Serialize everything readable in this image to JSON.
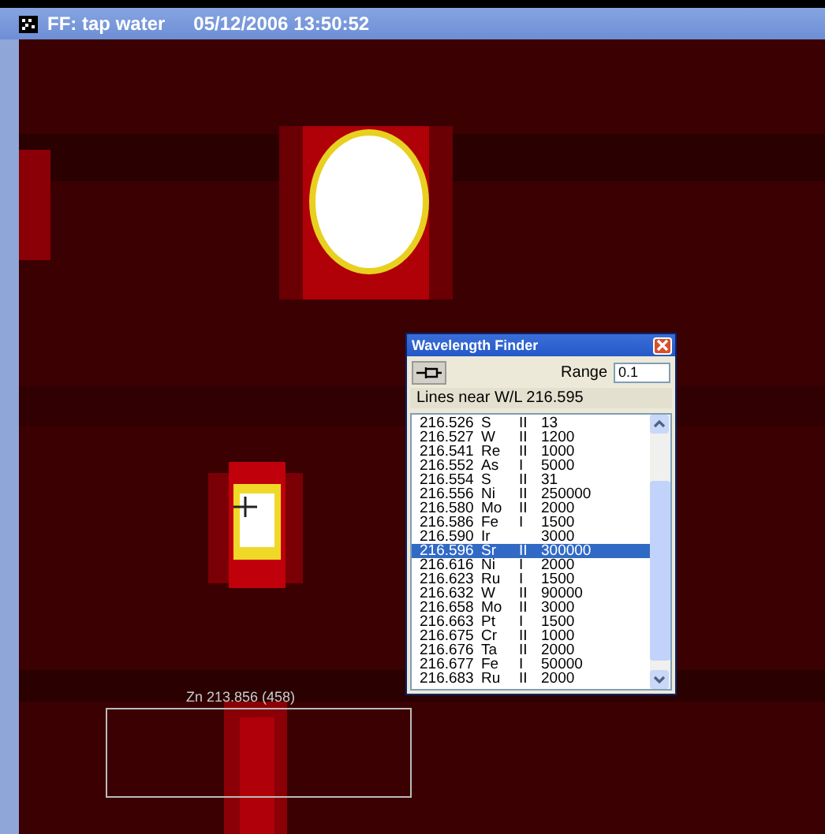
{
  "window": {
    "title": "FF: tap water",
    "timestamp": "05/12/2006 13:50:52"
  },
  "region_label": "Zn 213.856 (458)",
  "finder": {
    "title": "Wavelength Finder",
    "range_label": "Range",
    "range_value": "0.1",
    "lines_near": "Lines near W/L  216.595",
    "lines": [
      {
        "wavelength": "216.526",
        "element": "S",
        "ion": "II",
        "intensity": "13",
        "selected": false
      },
      {
        "wavelength": "216.527",
        "element": "W",
        "ion": "II",
        "intensity": "1200",
        "selected": false
      },
      {
        "wavelength": "216.541",
        "element": "Re",
        "ion": "II",
        "intensity": "1000",
        "selected": false
      },
      {
        "wavelength": "216.552",
        "element": "As",
        "ion": "I",
        "intensity": "5000",
        "selected": false
      },
      {
        "wavelength": "216.554",
        "element": "S",
        "ion": "II",
        "intensity": "31",
        "selected": false
      },
      {
        "wavelength": "216.556",
        "element": "Ni",
        "ion": "II",
        "intensity": "250000",
        "selected": false
      },
      {
        "wavelength": "216.580",
        "element": "Mo",
        "ion": "II",
        "intensity": "2000",
        "selected": false
      },
      {
        "wavelength": "216.586",
        "element": "Fe",
        "ion": "I",
        "intensity": "1500",
        "selected": false
      },
      {
        "wavelength": "216.590",
        "element": "Ir",
        "intensity": "3000",
        "selected": false
      },
      {
        "wavelength": "216.596",
        "element": "Sr",
        "ion": "II",
        "intensity": "300000",
        "selected": true
      },
      {
        "wavelength": "216.616",
        "element": "Ni",
        "ion": "I",
        "intensity": "2000",
        "selected": false
      },
      {
        "wavelength": "216.623",
        "element": "Ru",
        "ion": "I",
        "intensity": "1500",
        "selected": false
      },
      {
        "wavelength": "216.632",
        "element": "W",
        "ion": "II",
        "intensity": "90000",
        "selected": false
      },
      {
        "wavelength": "216.658",
        "element": "Mo",
        "ion": "II",
        "intensity": "3000",
        "selected": false
      },
      {
        "wavelength": "216.663",
        "element": "Pt",
        "ion": "I",
        "intensity": "1500",
        "selected": false
      },
      {
        "wavelength": "216.675",
        "element": "Cr",
        "ion": "II",
        "intensity": "1000",
        "selected": false
      },
      {
        "wavelength": "216.676",
        "element": "Ta",
        "ion": "II",
        "intensity": "2000",
        "selected": false
      },
      {
        "wavelength": "216.677",
        "element": "Fe",
        "ion": "I",
        "intensity": "50000",
        "selected": false
      },
      {
        "wavelength": "216.683",
        "element": "Ru",
        "ion": "II",
        "intensity": "2000",
        "selected": false
      }
    ]
  }
}
